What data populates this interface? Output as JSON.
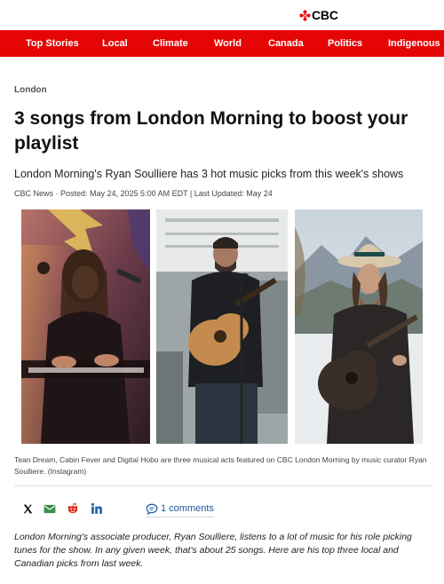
{
  "header": {
    "logo_text": "CBC",
    "logo_icon": "cbc-gem-icon",
    "brand_color": "#e60505"
  },
  "nav": {
    "items": [
      "Top Stories",
      "Local",
      "Climate",
      "World",
      "Canada",
      "Politics",
      "Indigenous"
    ]
  },
  "article": {
    "section": "London",
    "headline": "3 songs from London Morning to boost your playlist",
    "dek": "London Morning's Ryan Soulliere has 3 hot music picks from this week's shows",
    "byline": "CBC News · Posted: May 24, 2025 5:00 AM EDT | Last Updated: May 24",
    "photo_caption": "Tean Dream, Cabin Fever and Digital Hobo are three musical acts featured on CBC London Morning by music curator Ryan Soulliere. (Instagram)",
    "body_intro": "London Morning's associate producer, Ryan Soulliere, listens to a lot of music for his role picking tunes for the show. In any given week, that's about 25 songs. Here are his top three local and Canadian picks from last week."
  },
  "share": {
    "icons": [
      "x-icon",
      "email-icon",
      "reddit-icon",
      "linkedin-icon"
    ],
    "comments_label": "1 comments",
    "comments_icon": "comment-bubble-icon"
  }
}
